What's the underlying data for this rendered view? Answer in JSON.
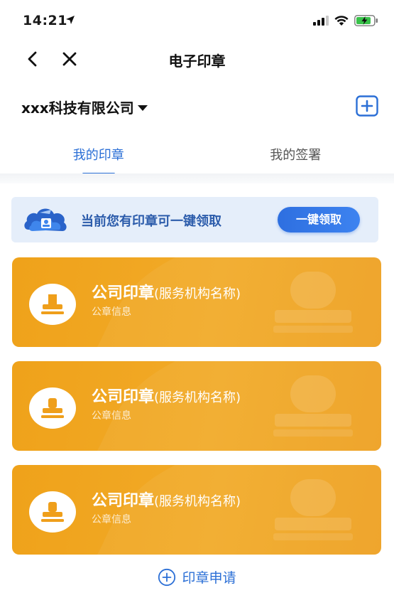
{
  "status_bar": {
    "time": "14:21",
    "location_icon": "location-arrow-icon",
    "signal_icon": "cellular-signal-icon",
    "wifi_icon": "wifi-icon",
    "battery_icon": "battery-charging-icon"
  },
  "nav": {
    "title": "电子印章",
    "back_icon": "chevron-left-icon",
    "close_icon": "close-icon"
  },
  "company": {
    "name": "xxx科技有限公司",
    "caret_icon": "caret-down-icon",
    "add_icon": "plus-square-icon"
  },
  "tabs": [
    {
      "label": "我的印章",
      "active": true
    },
    {
      "label": "我的签署",
      "active": false
    }
  ],
  "notice": {
    "text": "当前您有印章可一键领取",
    "button_label": "一键领取",
    "illustration_icon": "cloud-seal-icon"
  },
  "seals": [
    {
      "title": "公司印章",
      "subtitle": "(服务机构名称)",
      "info": "公章信息"
    },
    {
      "title": "公司印章",
      "subtitle": "(服务机构名称)",
      "info": "公章信息"
    },
    {
      "title": "公司印章",
      "subtitle": "(服务机构名称)",
      "info": "公章信息"
    }
  ],
  "apply": {
    "label": "印章申请",
    "icon": "plus-circle-icon"
  },
  "colors": {
    "accent": "#2b6fd6",
    "card_orange": "#f0a421",
    "notice_bg": "#e5eefa"
  }
}
